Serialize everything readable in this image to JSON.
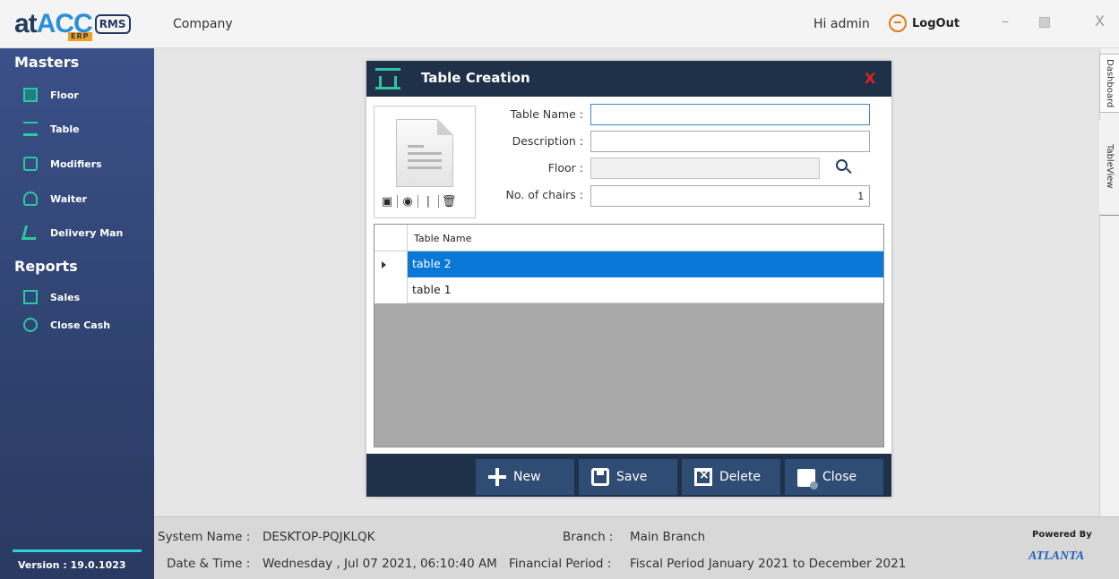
{
  "header": {
    "logo_at": "at",
    "logo_acc": "ACC",
    "logo_erp": "ERP",
    "logo_rms": "RMS",
    "company_label": "Company",
    "greeting": "Hi admin",
    "logout_label": "LogOut",
    "minimize_symbol": "–",
    "close_symbol": "X"
  },
  "sidebar": {
    "masters_title": "Masters",
    "masters_items": [
      {
        "label": "Floor",
        "icon": "floor-icon"
      },
      {
        "label": "Table",
        "icon": "table-icon"
      },
      {
        "label": "Modifiers",
        "icon": "modifiers-icon"
      },
      {
        "label": "Waiter",
        "icon": "waiter-icon"
      },
      {
        "label": "Delivery Man",
        "icon": "delivery-man-icon"
      }
    ],
    "reports_title": "Reports",
    "reports_items": [
      {
        "label": "Sales",
        "icon": "sales-icon"
      },
      {
        "label": "Close Cash",
        "icon": "close-cash-icon"
      }
    ],
    "version": "Version :  19.0.1023"
  },
  "right_tabs": {
    "dashboard": "Dashboard",
    "tableview": "TableView"
  },
  "dialog": {
    "title": "Table Creation",
    "close_symbol": "X",
    "image_tools": [
      "camera-icon",
      "webcam-icon",
      "scanner-icon",
      "trash-icon"
    ],
    "fields": {
      "table_name_label": "Table Name :",
      "table_name_value": "",
      "description_label": "Description :",
      "description_value": "",
      "floor_label": "Floor :",
      "floor_value": "",
      "chairs_label": "No. of chairs :",
      "chairs_value": "1"
    },
    "grid": {
      "column_header": "Table Name",
      "rows": [
        {
          "name": "table 2",
          "selected": true
        },
        {
          "name": "table 1",
          "selected": false
        }
      ]
    },
    "buttons": {
      "new": "New",
      "save": "Save",
      "delete": "Delete",
      "close": "Close"
    }
  },
  "statusbar": {
    "system_name_label": "System Name :",
    "system_name_value": "DESKTOP-PQJKLQK",
    "branch_label": "Branch :",
    "branch_value": "Main Branch",
    "datetime_label": "Date & Time :",
    "datetime_value": "Wednesday , Jul 07 2021, 06:10:40 AM",
    "financial_period_label": "Financial Period :",
    "financial_period_value": "Fiscal Period January 2021 to December 2021",
    "powered_by": "Powered By",
    "atlanta": "ATLANTA"
  },
  "colors": {
    "sidebar": "#3a5088",
    "dialog_header": "#1f3148",
    "selected_row": "#0a78d7",
    "close_red": "#e32020",
    "accent_teal": "#2fc7a0"
  }
}
